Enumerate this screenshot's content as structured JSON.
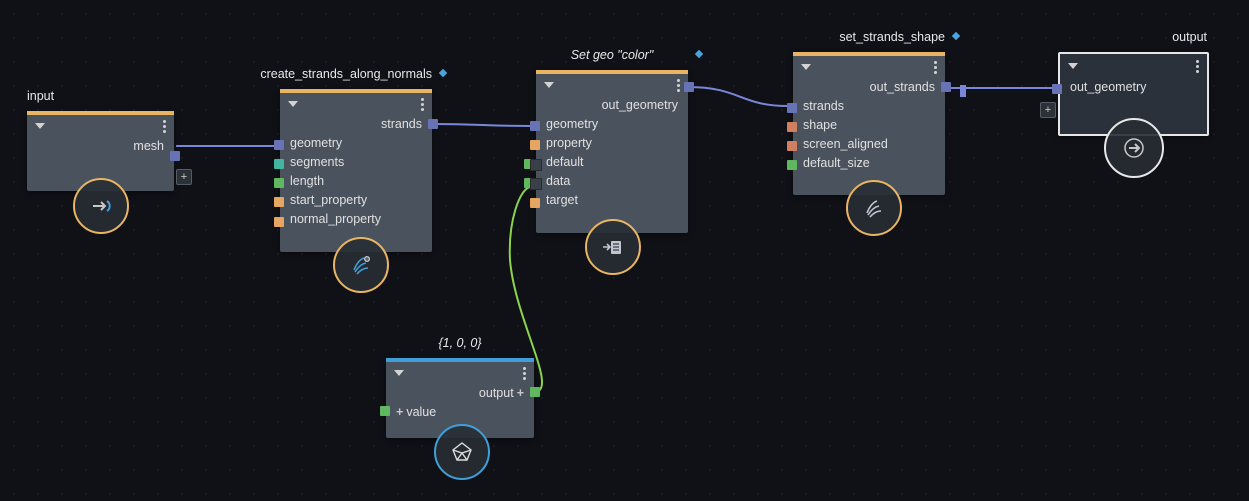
{
  "nodes": {
    "input": {
      "title": "input",
      "out0": "mesh"
    },
    "create": {
      "title": "create_strands_along_normals",
      "out0": "strands",
      "in0": "geometry",
      "in1": "segments",
      "in2": "length",
      "in3": "start_property",
      "in4": "normal_property"
    },
    "setgeo": {
      "title": "Set geo \"color\"",
      "out0": "out_geometry",
      "in0": "geometry",
      "in1": "property",
      "in2": "default",
      "in3": "data",
      "in4": "target"
    },
    "setshape": {
      "title": "set_strands_shape",
      "out0": "out_strands",
      "in0": "strands",
      "in1": "shape",
      "in2": "screen_aligned",
      "in3": "default_size"
    },
    "output": {
      "title": "output",
      "in0": "out_geometry"
    },
    "value": {
      "title": "{1, 0, 0}",
      "out0": "output",
      "in0": "value"
    }
  }
}
